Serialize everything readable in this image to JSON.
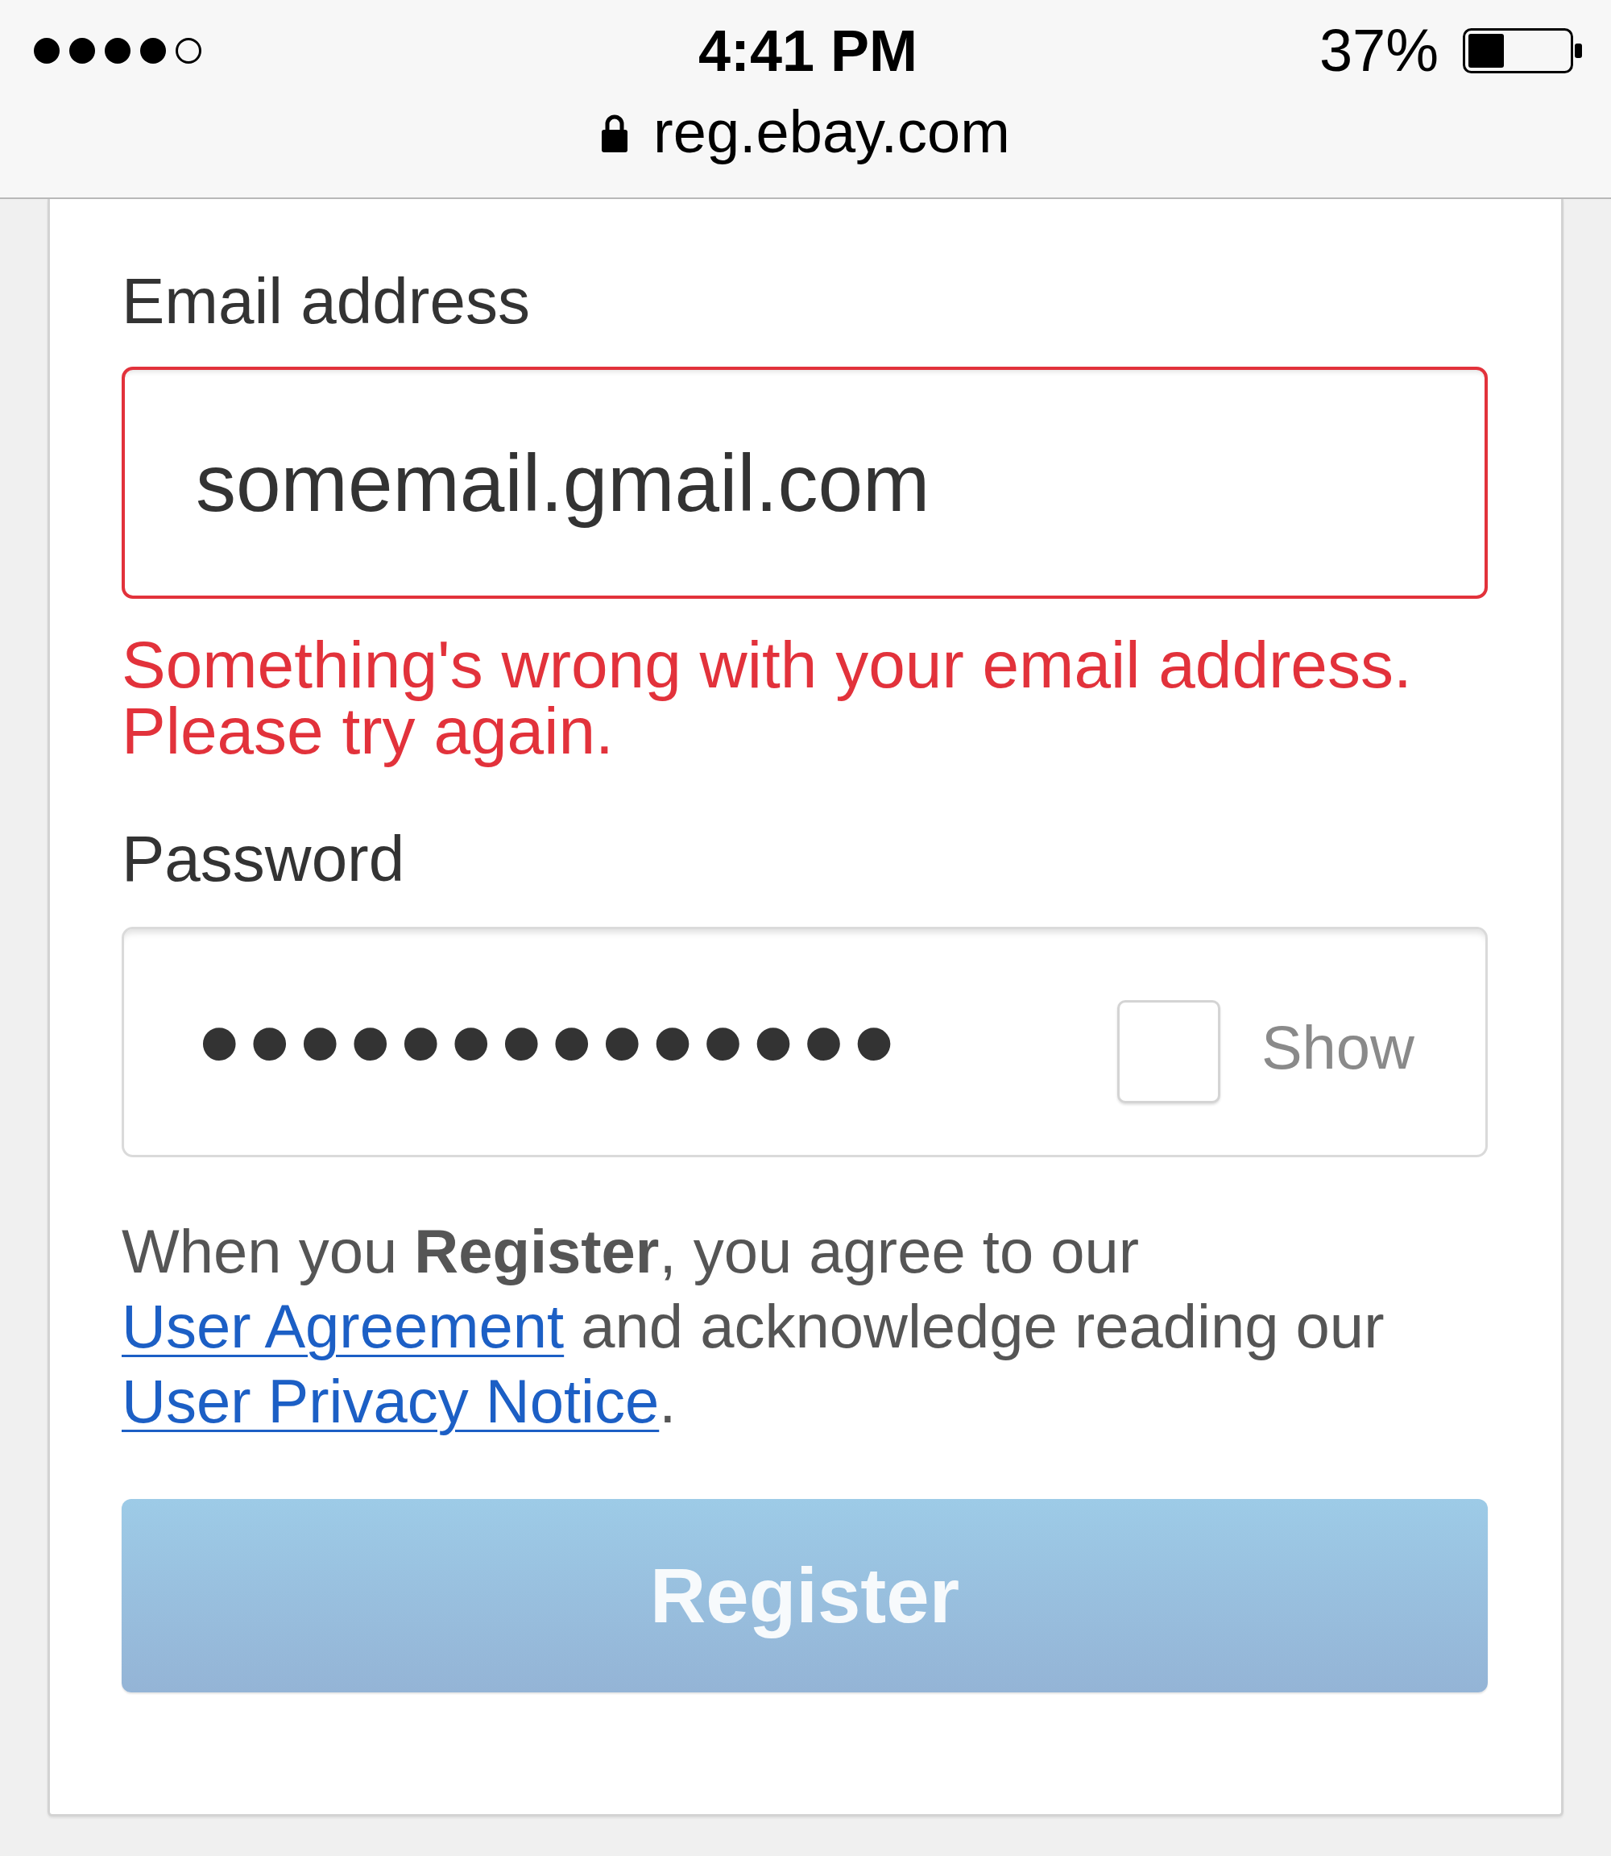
{
  "status_bar": {
    "time": "4:41 PM",
    "battery": "37%",
    "url": "reg.ebay.com"
  },
  "form": {
    "fields": [
      {
        "kind": "email",
        "label": "Email address",
        "value": "somemail.gmail.com",
        "invalid": true,
        "error": "Something's wrong with your email address. Please try again."
      },
      {
        "kind": "password",
        "label": "Password",
        "value": "••••••••••••••",
        "invalid": false,
        "show_option": {
          "label": "Show",
          "checked": false
        }
      }
    ],
    "terms": [
      {
        "kind": "text",
        "text": "When you **Register**, you agree to our "
      },
      {
        "kind": "link",
        "text": "User Agreement"
      },
      {
        "kind": "text",
        "text": " and acknowledge reading our "
      },
      {
        "kind": "link",
        "text": "User Privacy Notice"
      },
      {
        "kind": "text",
        "text": "."
      }
    ],
    "submit": {
      "label": "Register",
      "disabled": true
    }
  }
}
